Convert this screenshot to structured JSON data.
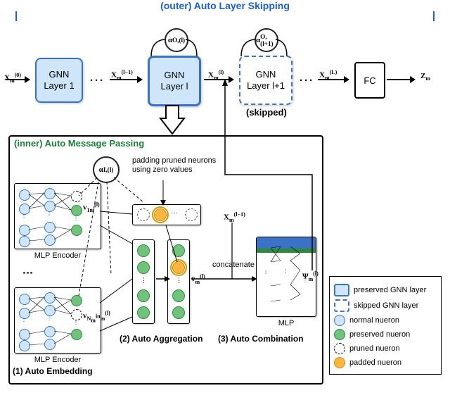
{
  "outer_title": "(outer) Auto Layer Skipping",
  "inner_title": "(inner) Auto Message Passing",
  "row": {
    "x0": "X<sub>m</sub><sup>(0)</sup>",
    "gnn1_l1": "GNN",
    "gnn1_l2": "Layer 1",
    "xlm1": "X<sub>m</sub><sup>(l−1)</sup>",
    "gnnl_l1": "GNN",
    "gnnl_l2": "Layer l",
    "xl": "X<sub>m</sub><sup>(l)</sup>",
    "gnnlp1_l1": "GNN",
    "gnnlp1_l2": "Layer l+1",
    "xL": "X<sub>m</sub><sup>(L)</sup>",
    "fc": "FC",
    "zm": "Z<sub>m</sub>",
    "skipped": "(skipped)",
    "alpha_l": "α<sup>O,(l)</sup>",
    "alpha_lp1": "α<sup>O,(l+1)</sup>"
  },
  "inner": {
    "alpha_I": "α<sup>I,(l)</sup>",
    "pad_hint": "padding pruned neurons\nusing zero values",
    "v1": "v<sub>1m</sub><sup>(l)</sup>",
    "vN": "v<sub>N<sub>m</sub><sup>in</sup>m</sub><sup>(l)</sup>",
    "mlp_enc": "MLP Encoder",
    "vbar": "v̄<sub>m</sub><sup>(l)</sup>",
    "xconcat": "X<sub>m</sub><sup>(l−1)</sup>",
    "concat": "concatenate",
    "mlp": "MLP",
    "psi": "Ψ<sub>m</sub><sup>(l)</sup>",
    "s1": "(1) Auto Embedding",
    "s2": "(2) Auto Aggregation",
    "s3": "(3) Auto Combination"
  },
  "legend": {
    "preserved_layer": "preserved GNN layer",
    "skipped_layer": "skipped GNN  layer",
    "normal": "normal nueron",
    "preserved": "preserved nueron",
    "pruned": "pruned nueron",
    "padded": "padded nueron"
  }
}
